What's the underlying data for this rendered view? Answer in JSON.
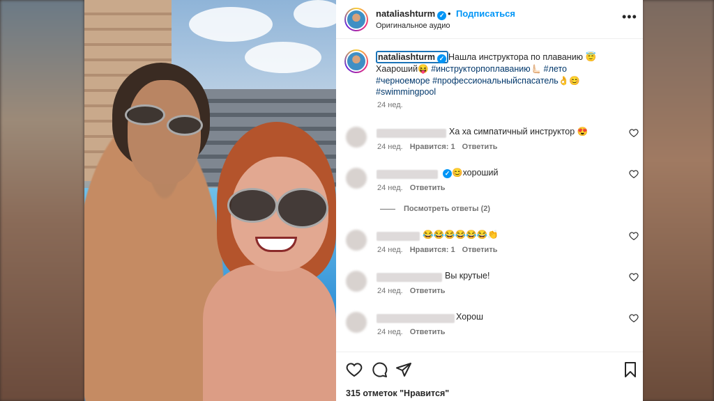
{
  "post": {
    "username": "nataliashturm",
    "verified_mark": "✓",
    "dot": "•",
    "follow_label": "Подписаться",
    "audio_label": "Оригинальное аудио",
    "more_label": "•••"
  },
  "caption": {
    "username": "nataliashturm",
    "text_part1": "Нашла инструктора по плаванию 😇",
    "text_part2": "Хаароший😝 ",
    "hashtags": [
      "#инструкторпоплаванию",
      "#лето",
      "#черноеморе",
      "#профессиональныйспасатель",
      "#swimmingpool"
    ],
    "after_tag3": "👌😊",
    "after_tag1": "🫷🏻 ",
    "time": "24 нед."
  },
  "comments": [
    {
      "text": "Ха ха симпатичный инструктор 😍",
      "time": "24 нед.",
      "likes": "Нравится: 1",
      "reply": "Ответить",
      "verified": false
    },
    {
      "text": "😊хороший",
      "time": "24 нед.",
      "likes": "",
      "reply": "Ответить",
      "verified": true
    },
    {
      "text": "😂😂😂😂😂😂👏",
      "time": "24 нед.",
      "likes": "Нравится: 1",
      "reply": "Ответить",
      "verified": false
    },
    {
      "text": "Вы крутые!",
      "time": "24 нед.",
      "likes": "",
      "reply": "Ответить",
      "verified": false
    },
    {
      "text": "Хорош",
      "time": "24 нед.",
      "likes": "",
      "reply": "Ответить",
      "verified": false
    }
  ],
  "view_replies_label": "Посмотреть ответы (2)",
  "likes_count": "315 отметок \"Нравится\"",
  "icons": {
    "like": "heart-icon",
    "comment": "comment-icon",
    "share": "share-icon",
    "save": "bookmark-icon"
  },
  "colors": {
    "accent": "#0095f6",
    "hashtag": "#00376b",
    "meta": "#737373"
  }
}
